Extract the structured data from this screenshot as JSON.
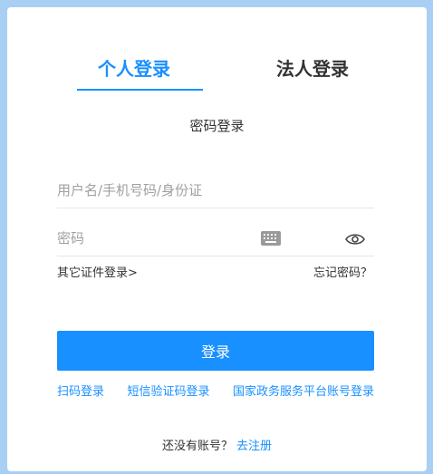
{
  "tabs": {
    "personal": "个人登录",
    "legal": "法人登录"
  },
  "subtitle": "密码登录",
  "form": {
    "username_placeholder": "用户名/手机号码/身份证",
    "password_placeholder": "密码"
  },
  "links": {
    "other_id_login": "其它证件登录>",
    "forgot_password": "忘记密码？"
  },
  "login_button": "登录",
  "alt_logins": [
    "扫码登录",
    "短信验证码登录",
    "国家政务服务平台账号登录"
  ],
  "register": {
    "prompt": "还没有账号？",
    "link": "去注册"
  },
  "icons": {
    "keyboard": "keyboard-icon",
    "eye": "eye-icon"
  },
  "colors": {
    "accent": "#1890ff",
    "background": "#a9cff5",
    "text": "#333333"
  }
}
